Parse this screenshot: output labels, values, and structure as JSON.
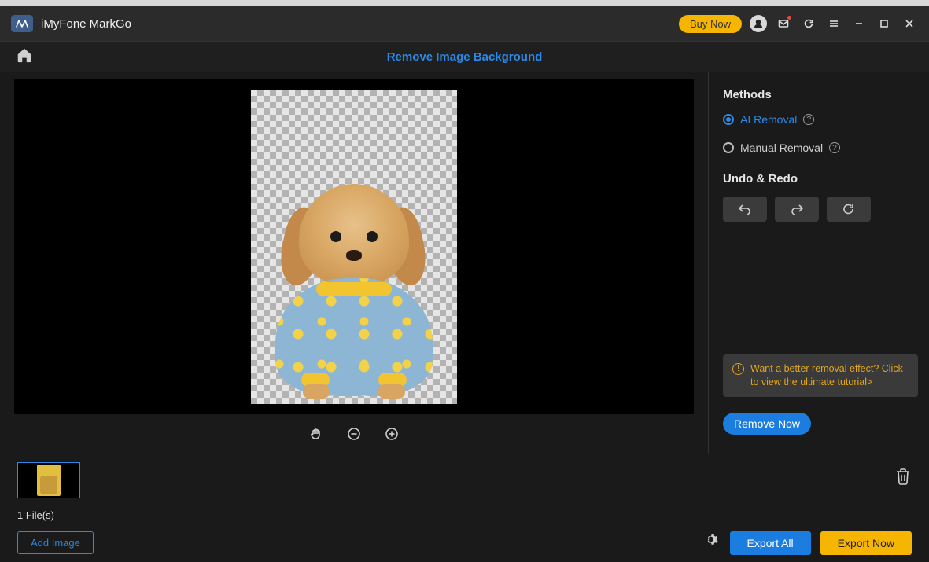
{
  "titlebar": {
    "app_name": "iMyFone MarkGo",
    "buy_now": "Buy Now"
  },
  "toolbar": {
    "page_title": "Remove Image Background"
  },
  "sidebar": {
    "methods_heading": "Methods",
    "ai_removal_label": "AI Removal",
    "manual_removal_label": "Manual Removal",
    "undo_redo_heading": "Undo & Redo",
    "tip_text": "Want a better removal effect? Click to view the ultimate tutorial>",
    "remove_now": "Remove Now"
  },
  "thumbs": {
    "file_count": "1 File(s)"
  },
  "footer": {
    "add_image": "Add Image",
    "export_all": "Export All",
    "export_now": "Export Now"
  }
}
